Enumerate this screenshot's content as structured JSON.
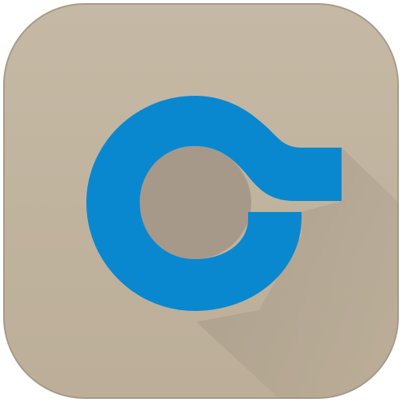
{
  "icon": {
    "name": "app-icon",
    "glyph": "swirl-hook-logo-icon",
    "colors": {
      "tile_light": "#c5b9a5",
      "tile_mid": "#bcae98",
      "tile_edge": "#a79b88",
      "inner_fill": "#a6998a",
      "shadow": "#8f8474",
      "glyph": "#0a88cf"
    }
  }
}
